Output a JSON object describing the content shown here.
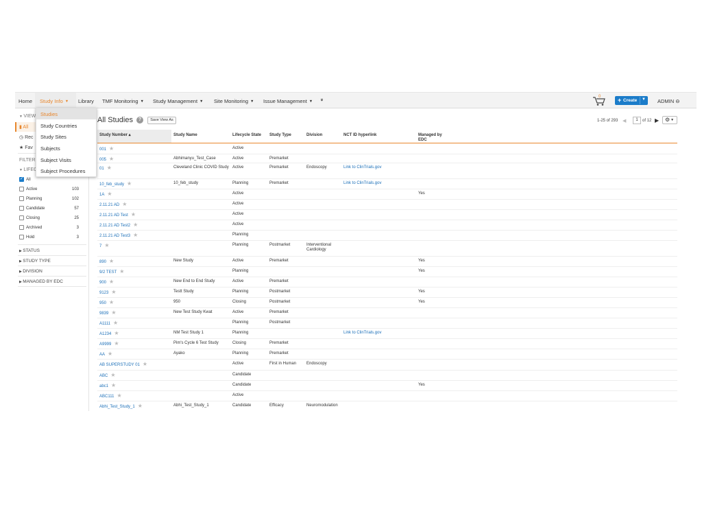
{
  "nav": {
    "items": [
      "Home",
      "Study Info",
      "Library",
      "TMF Monitoring",
      "Study Management",
      "Site Monitoring",
      "Issue Management"
    ],
    "more": "»",
    "cart_count": "0",
    "create_label": "Create",
    "user": "ADMIN"
  },
  "dropdown": {
    "items": [
      "Studies",
      "Study Countries",
      "Study Sites",
      "Subjects",
      "Subject Visits",
      "Subject Procedures"
    ],
    "selected": "Studies"
  },
  "sidebar": {
    "views_header": "VIEW",
    "views": [
      "All",
      "Rec",
      "Fav"
    ],
    "filters_header": "FILTER",
    "lifecycle_header": "LIFEC",
    "lifecycle": [
      {
        "label": "All",
        "count": "",
        "checked": true
      },
      {
        "label": "Active",
        "count": "103",
        "checked": false
      },
      {
        "label": "Planning",
        "count": "102",
        "checked": false
      },
      {
        "label": "Candidate",
        "count": "57",
        "checked": false
      },
      {
        "label": "Closing",
        "count": "25",
        "checked": false
      },
      {
        "label": "Archived",
        "count": "3",
        "checked": false
      },
      {
        "label": "Hold",
        "count": "3",
        "checked": false
      }
    ],
    "collapsed": [
      "STATUS",
      "STUDY TYPE",
      "DIVISION",
      "MANAGED BY EDC"
    ]
  },
  "main": {
    "title": "All Studies",
    "save_view": "Save View As",
    "pager_range": "1-25 of 293",
    "page": "1",
    "page_of": "of 12"
  },
  "columns": [
    "Study Number ▴",
    "Study Name",
    "Lifecycle State",
    "Study Type",
    "Division",
    "NCT ID hyperlink",
    "Managed by EDC"
  ],
  "rows": [
    {
      "num": "001",
      "name": "",
      "state": "Active",
      "type": "",
      "div": "",
      "nct": "",
      "edc": ""
    },
    {
      "num": "005",
      "name": "Abhimanyu_Test_Case",
      "state": "Active",
      "type": "Premarket",
      "div": "",
      "nct": "",
      "edc": ""
    },
    {
      "num": "01",
      "name": "Cleveland Clinic COVID Study",
      "state": "Active",
      "type": "Premarket",
      "div": "Endoscopy",
      "nct": "Link to ClinTrials.gov",
      "edc": ""
    },
    {
      "num": "10_feb_study",
      "name": "10_feb_study",
      "state": "Planning",
      "type": "Premarket",
      "div": "",
      "nct": "Link to ClinTrials.gov",
      "edc": ""
    },
    {
      "num": "1A",
      "name": "",
      "state": "Active",
      "type": "",
      "div": "",
      "nct": "",
      "edc": "Yes"
    },
    {
      "num": "2.11.21 AD",
      "name": "",
      "state": "Active",
      "type": "",
      "div": "",
      "nct": "",
      "edc": ""
    },
    {
      "num": "2.11.21 AD Test",
      "name": "",
      "state": "Active",
      "type": "",
      "div": "",
      "nct": "",
      "edc": ""
    },
    {
      "num": "2.11.21 AD Test2",
      "name": "",
      "state": "Active",
      "type": "",
      "div": "",
      "nct": "",
      "edc": ""
    },
    {
      "num": "2.11.21 AD Test3",
      "name": "",
      "state": "Planning",
      "type": "",
      "div": "",
      "nct": "",
      "edc": ""
    },
    {
      "num": "7",
      "name": "",
      "state": "Planning",
      "type": "Postmarket",
      "div": "Interventional Cardiology",
      "nct": "",
      "edc": ""
    },
    {
      "num": "890",
      "name": "New Study",
      "state": "Active",
      "type": "Premarket",
      "div": "",
      "nct": "",
      "edc": "Yes"
    },
    {
      "num": "9/2 TEST",
      "name": "",
      "state": "Planning",
      "type": "",
      "div": "",
      "nct": "",
      "edc": "Yes"
    },
    {
      "num": "900",
      "name": "New End to End Study",
      "state": "Active",
      "type": "Premarket",
      "div": "",
      "nct": "",
      "edc": ""
    },
    {
      "num": "9123",
      "name": "Testt Study",
      "state": "Planning",
      "type": "Postmarket",
      "div": "",
      "nct": "",
      "edc": "Yes"
    },
    {
      "num": "950",
      "name": "950",
      "state": "Closing",
      "type": "Postmarket",
      "div": "",
      "nct": "",
      "edc": "Yes"
    },
    {
      "num": "9839",
      "name": "New Test Study Kwat",
      "state": "Active",
      "type": "Premarket",
      "div": "",
      "nct": "",
      "edc": ""
    },
    {
      "num": "A1111",
      "name": "",
      "state": "Planning",
      "type": "Postmarket",
      "div": "",
      "nct": "",
      "edc": ""
    },
    {
      "num": "A1234",
      "name": "NM Test Study 1",
      "state": "Planning",
      "type": "",
      "div": "",
      "nct": "Link to ClinTrials.gov",
      "edc": ""
    },
    {
      "num": "A9999",
      "name": "Pim's Cycle 6 Test Study",
      "state": "Closing",
      "type": "Premarket",
      "div": "",
      "nct": "",
      "edc": ""
    },
    {
      "num": "AA",
      "name": "Ayako",
      "state": "Planning",
      "type": "Premarket",
      "div": "",
      "nct": "",
      "edc": ""
    },
    {
      "num": "AB SUPERSTUDY 01",
      "name": "",
      "state": "Active",
      "type": "First in Human",
      "div": "Endoscopy",
      "nct": "",
      "edc": ""
    },
    {
      "num": "ABC",
      "name": "",
      "state": "Candidate",
      "type": "",
      "div": "",
      "nct": "",
      "edc": ""
    },
    {
      "num": "abc1",
      "name": "",
      "state": "Candidate",
      "type": "",
      "div": "",
      "nct": "",
      "edc": "Yes"
    },
    {
      "num": "ABC111",
      "name": "",
      "state": "Active",
      "type": "",
      "div": "",
      "nct": "",
      "edc": ""
    },
    {
      "num": "Abhi_Test_Study_1",
      "name": "Abhi_Test_Study_1",
      "state": "Candidate",
      "type": "Efficacy",
      "div": "Neuromodulation",
      "nct": "",
      "edc": ""
    }
  ],
  "colors": {
    "accent": "#e8862c",
    "primary": "#1b7cc9",
    "link": "#1b6fb8"
  }
}
